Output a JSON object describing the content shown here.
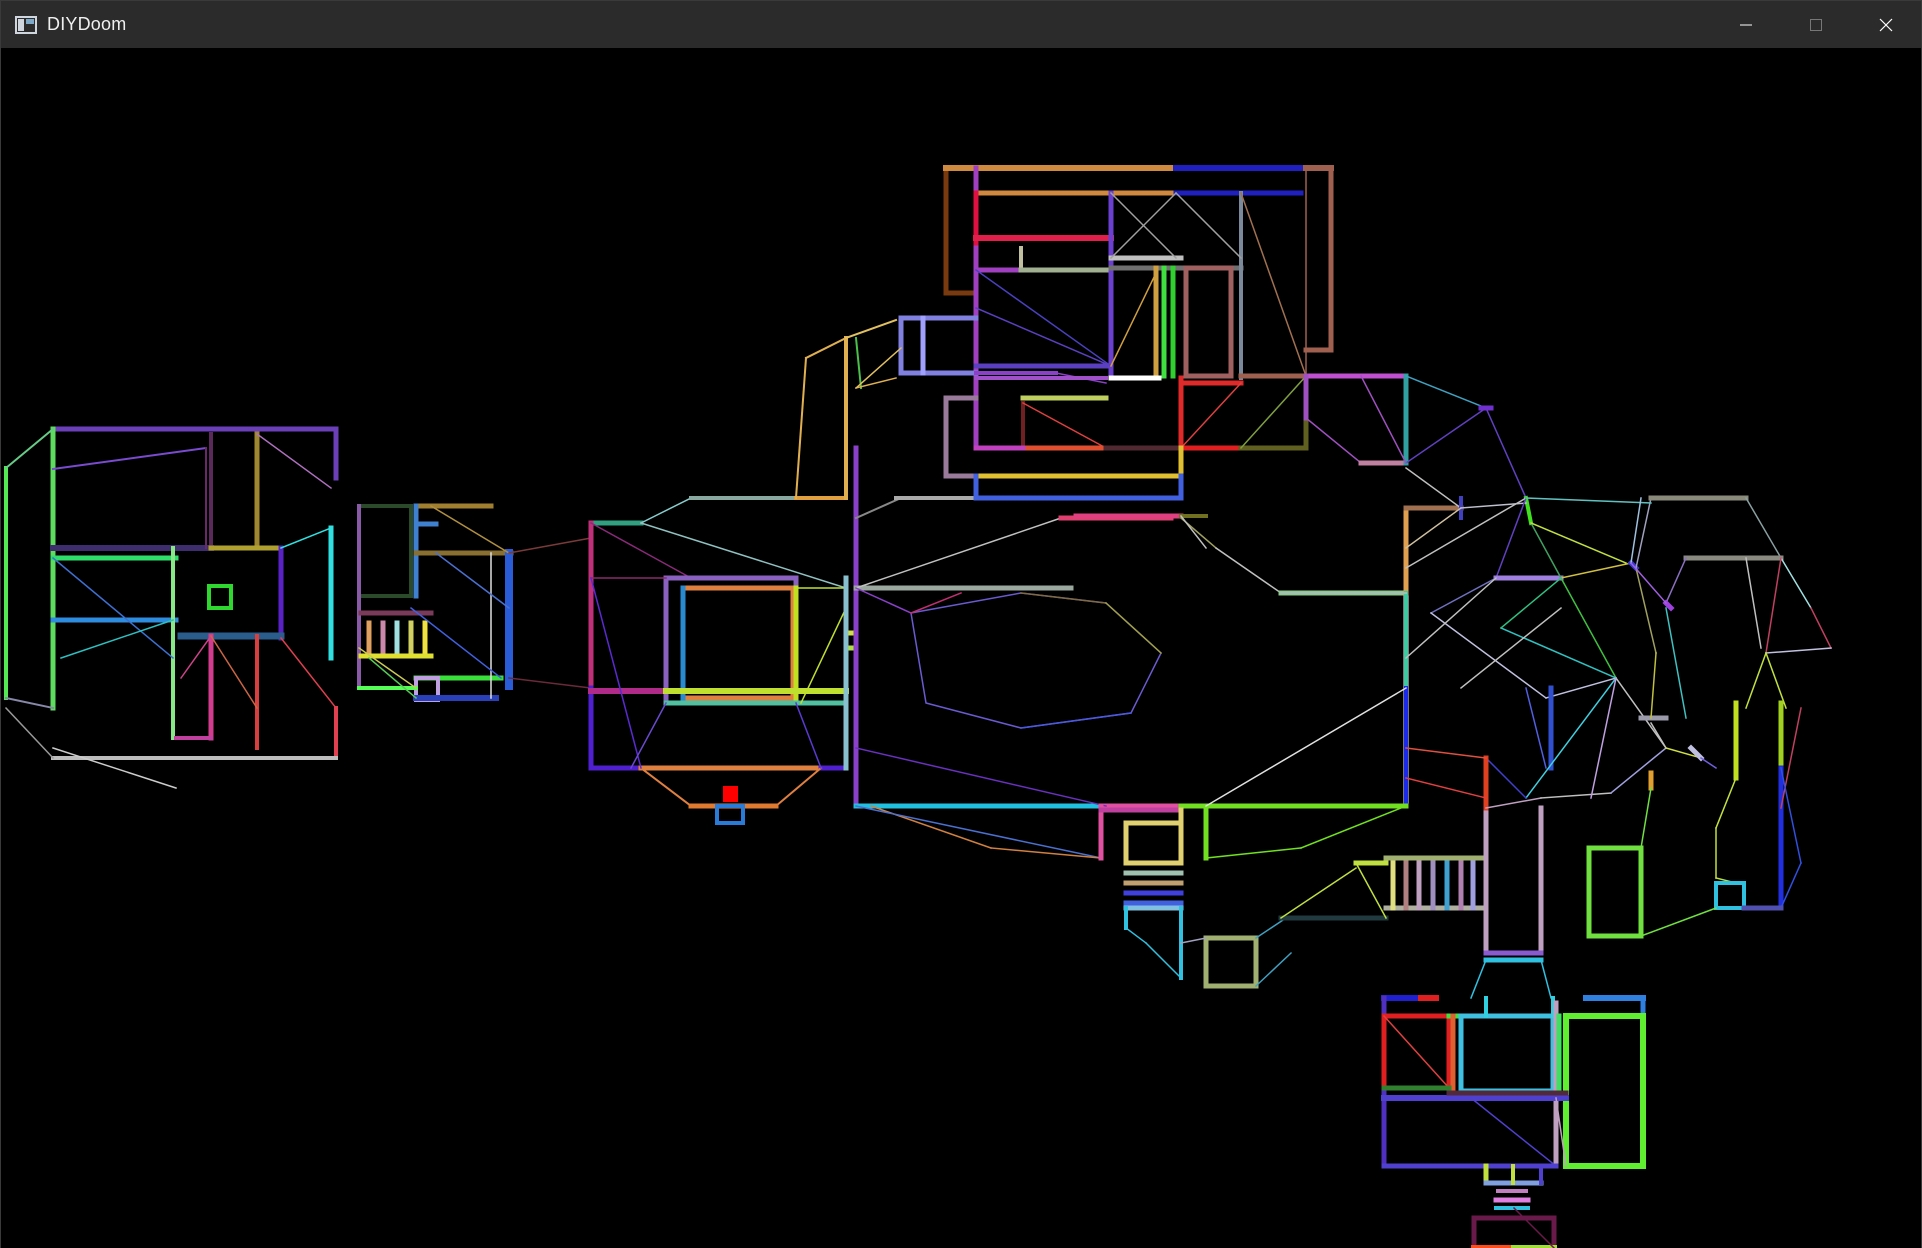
{
  "window": {
    "title": "DIYDoom",
    "controls": {
      "minimize": "minimize-icon",
      "maximize": "maximize-icon",
      "close": "close-icon"
    }
  },
  "app": {
    "icon": "window-app-icon",
    "background": "#000000"
  },
  "map": {
    "description_colors": {
      "background": "#000000"
    }
  }
}
